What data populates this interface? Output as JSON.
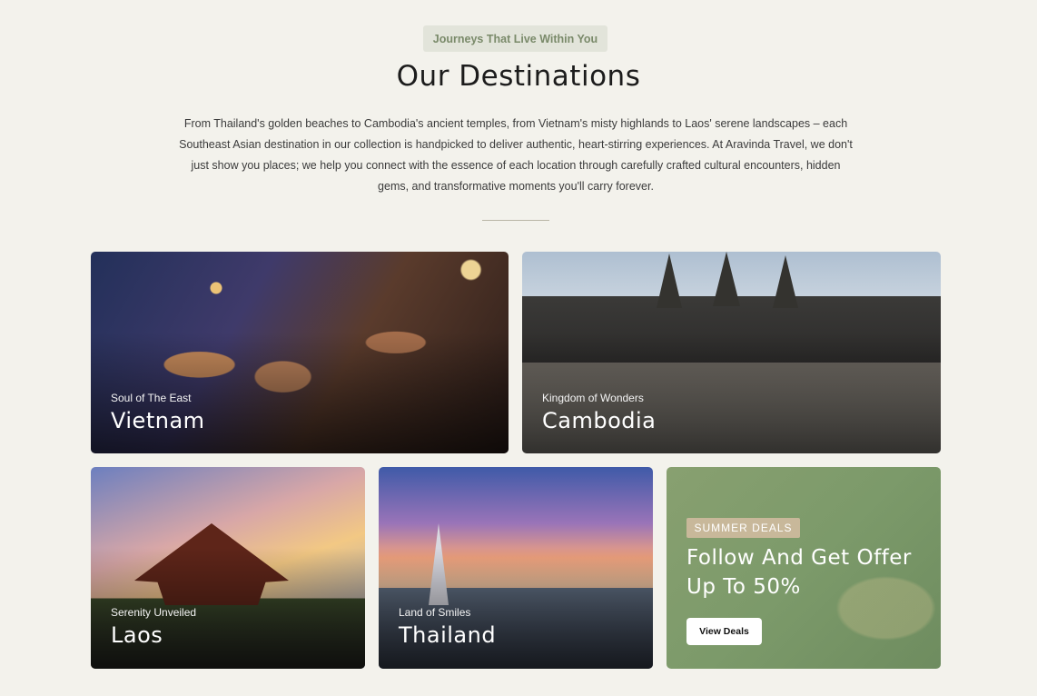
{
  "header": {
    "badge": "Journeys That Live Within You",
    "title": "Our Destinations",
    "intro": "From Thailand's golden beaches to Cambodia's ancient temples, from Vietnam's misty highlands to Laos' serene landscapes – each Southeast Asian destination in our collection is handpicked to deliver authentic, heart-stirring experiences. At Aravinda Travel, we don't just show you places; we help you connect with the essence of each location through carefully crafted cultural encounters, hidden gems, and transformative moments you'll carry forever."
  },
  "destinations": [
    {
      "subtitle": "Soul of The East",
      "name": "Vietnam"
    },
    {
      "subtitle": "Kingdom of Wonders",
      "name": "Cambodia"
    },
    {
      "subtitle": "Serenity Unveiled",
      "name": "Laos"
    },
    {
      "subtitle": "Land of Smiles",
      "name": "Thailand"
    }
  ],
  "offer": {
    "tag": "SUMMER DEALS",
    "title": "Follow And Get Offer Up To 50%",
    "button_label": "View Deals"
  },
  "colors": {
    "background": "#f3f2ec",
    "badge_bg": "#e2e4da",
    "badge_text": "#7a8a6a",
    "offer_bg": "#7c9a6a",
    "offer_tag_bg": "#c8b89a"
  }
}
